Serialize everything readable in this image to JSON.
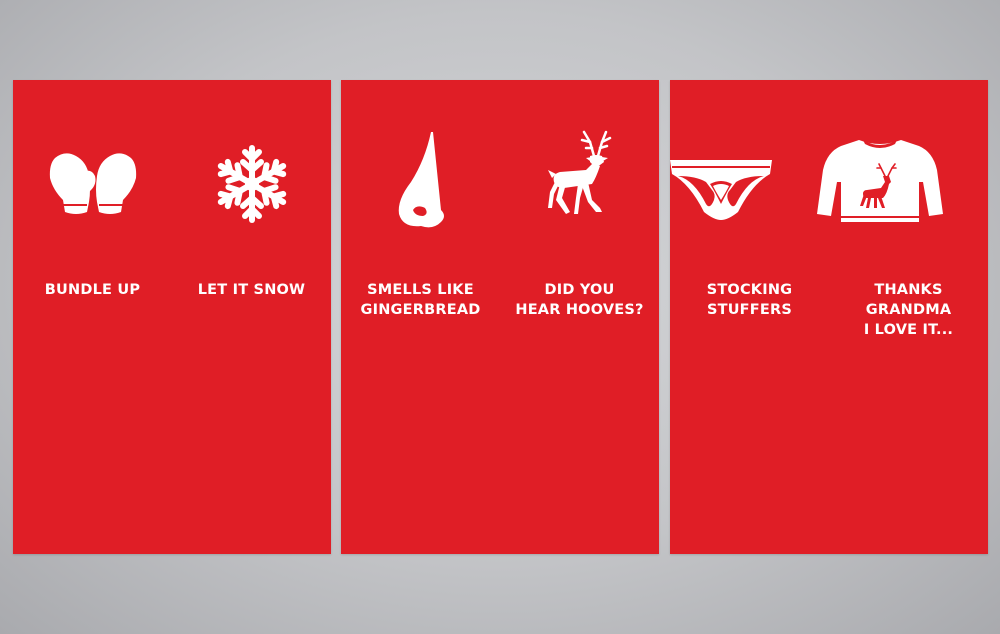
{
  "colors": {
    "card": "#e01e26",
    "icon": "#ffffff",
    "background": "#c3c4c7"
  },
  "cards": [
    {
      "items": [
        {
          "label": "BUNDLE UP",
          "icon": "mittens-icon"
        },
        {
          "label": "LET IT SNOW",
          "icon": "snowflake-icon"
        }
      ]
    },
    {
      "items": [
        {
          "label": "SMELLS LIKE\nGINGERBREAD",
          "icon": "nose-icon"
        },
        {
          "label": "DID YOU\nHEAR HOOVES?",
          "icon": "reindeer-icon"
        }
      ]
    },
    {
      "items": [
        {
          "label": "STOCKING\nSTUFFERS",
          "icon": "briefs-icon"
        },
        {
          "label": "THANKS GRANDMA\nI LOVE IT...",
          "icon": "sweater-icon"
        }
      ]
    }
  ]
}
